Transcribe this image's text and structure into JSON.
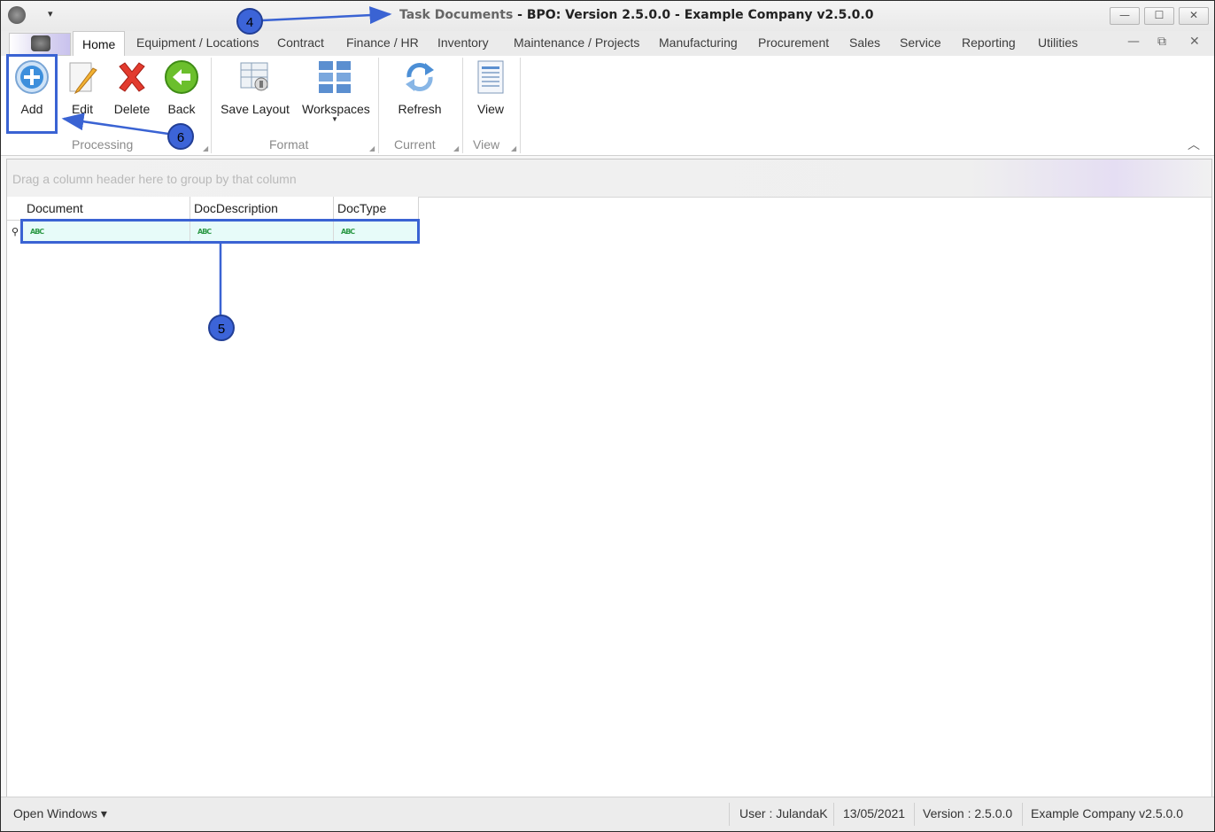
{
  "titlebar": {
    "title_part1": "Task Documents",
    "title_part2": " - BPO: Version 2.5.0.0 - Example Company v2.5.0.0",
    "qat_glyph": "▾",
    "minimize": "—",
    "maximize": "☐",
    "close": "✕"
  },
  "tabs": [
    {
      "label": "Home",
      "active": true
    },
    {
      "label": "Equipment / Locations"
    },
    {
      "label": "Contract"
    },
    {
      "label": "Finance / HR"
    },
    {
      "label": "Inventory"
    },
    {
      "label": "Maintenance / Projects"
    },
    {
      "label": "Manufacturing"
    },
    {
      "label": "Procurement"
    },
    {
      "label": "Sales"
    },
    {
      "label": "Service"
    },
    {
      "label": "Reporting"
    },
    {
      "label": "Utilities"
    }
  ],
  "mdi": {
    "minimize": "—",
    "restore": "⧉",
    "close": "✕"
  },
  "ribbon": {
    "add": "Add",
    "edit": "Edit",
    "delete": "Delete",
    "back": "Back",
    "save_layout": "Save Layout",
    "workspaces": "Workspaces",
    "refresh": "Refresh",
    "view": "View",
    "groups": {
      "processing": "Processing",
      "format": "Format",
      "current": "Current",
      "view": "View"
    },
    "icons": [
      "add-circle-icon",
      "edit-pencil-icon",
      "delete-x-icon",
      "back-arrow-icon",
      "save-layout-icon",
      "workspaces-grid-icon",
      "refresh-icon",
      "view-document-icon"
    ]
  },
  "grid": {
    "group_panel_hint": "Drag a column header here to group by that column",
    "columns": [
      "Document",
      "DocDescription",
      "DocType"
    ],
    "filter_row_glyph": "ABC",
    "filter_indicator": "⚲"
  },
  "statusbar": {
    "open_windows": "Open Windows ▾",
    "user": "User : JulandaK",
    "date": "13/05/2021",
    "version": "Version : 2.5.0.0",
    "company": "Example Company v2.5.0.0"
  },
  "annotations": {
    "badge4": "4",
    "badge5": "5",
    "badge6": "6"
  },
  "colors": {
    "annotation": "#3a63d3",
    "filter_row": "#e7fbf9",
    "delete_red": "#e23b2e",
    "back_green": "#6bbf2c"
  }
}
